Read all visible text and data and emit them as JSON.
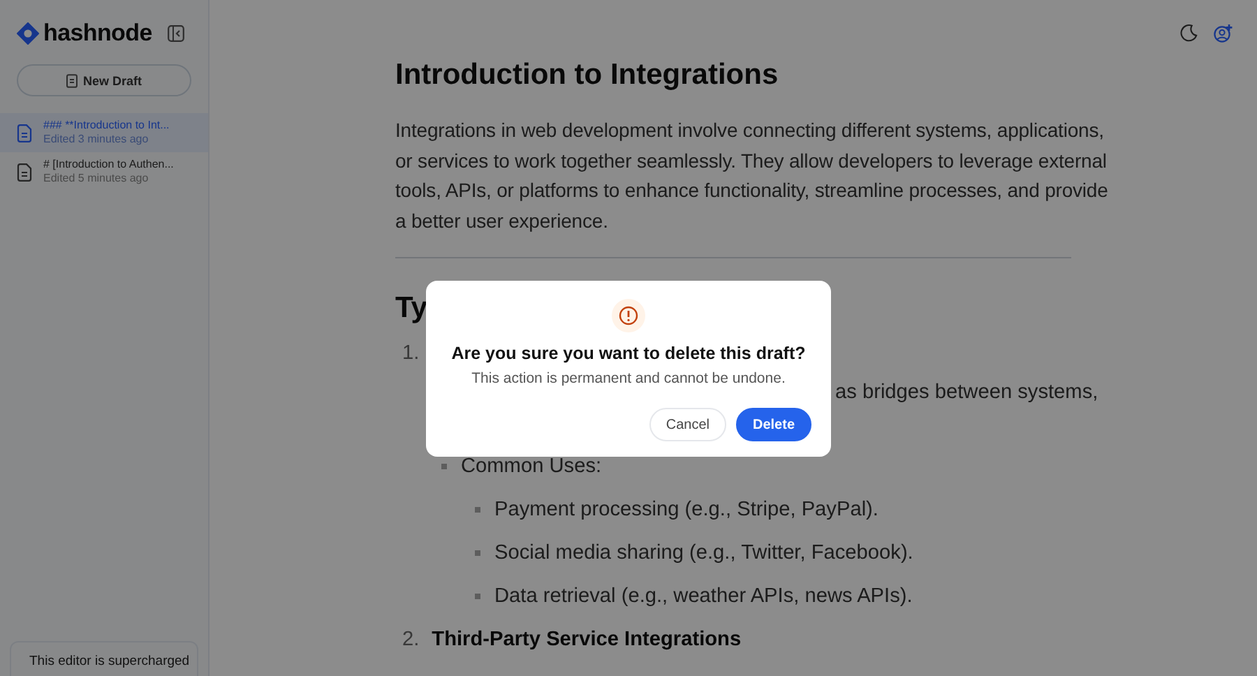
{
  "sidebar": {
    "logo": "hashnode",
    "new_draft_button": "New Draft",
    "drafts": [
      {
        "title": "### **Introduction to Int...",
        "subtitle": "Edited 3 minutes ago",
        "selected": true
      },
      {
        "title": "# [Introduction to Authen...",
        "subtitle": "Edited 5 minutes ago",
        "selected": false
      }
    ],
    "footer": "This editor is supercharged"
  },
  "article": {
    "title": "Introduction to Integrations",
    "intro": "Integrations in web development involve connecting different systems, applications, or services to work together seamlessly. They allow developers to leverage external tools, APIs, or platforms to enhance functionality, streamline processes, and provide a better user experience.",
    "section_heading": "Ty",
    "items": [
      {
        "marker": "1.",
        "text": "as bridges between systems,",
        "bullets": [
          {
            "text": "Common Uses:",
            "children": [
              {
                "text": "Payment processing (e.g., Stripe, PayPal)."
              },
              {
                "text": "Social media sharing (e.g., Twitter, Facebook)."
              },
              {
                "text": "Data retrieval (e.g., weather APIs, news APIs)."
              }
            ]
          }
        ]
      },
      {
        "marker": "2.",
        "heading": "Third-Party Service Integrations"
      }
    ]
  },
  "dialog": {
    "title": "Are you sure you want to delete this draft?",
    "message": "This action is permanent and cannot be undone.",
    "buttons": [
      {
        "label": "Cancel",
        "kind": "secondary"
      },
      {
        "label": "Delete",
        "kind": "primary"
      }
    ]
  }
}
